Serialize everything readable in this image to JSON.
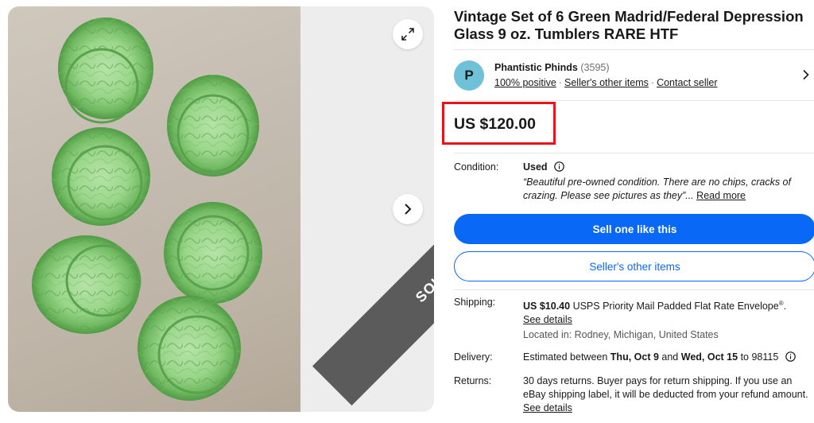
{
  "gallery": {
    "sold_label": "SOLD",
    "icons": {
      "expand": "expand-icon",
      "next": "chevron-right-icon"
    }
  },
  "listing": {
    "title": "Vintage Set of 6 Green Madrid/Federal Depression Glass 9 oz. Tumblers RARE HTF"
  },
  "seller": {
    "avatar_letter": "P",
    "name": "Phantistic Phinds",
    "feedback_count": "(3595)",
    "positive": "100% positive",
    "other_items_link": "Seller's other items",
    "contact_link": "Contact seller",
    "sep": "·"
  },
  "price": {
    "value": "US $120.00",
    "highlight_color": "#e5151b"
  },
  "condition": {
    "label": "Condition:",
    "value": "Used",
    "quote": "“Beautiful pre-owned condition. There are no chips, cracks of crazing. Please see pictures as they”...",
    "read_more": "Read more"
  },
  "actions": {
    "sell_one": "Sell one like this",
    "other_items": "Seller's other items",
    "primary_color": "#0968f6"
  },
  "shipping": {
    "label": "Shipping:",
    "amount": "US $10.40",
    "service": "USPS Priority Mail Padded Flat Rate Envelope",
    "reg": "®",
    "period": ".",
    "see_details": "See details",
    "located": "Located in: Rodney, Michigan, United States"
  },
  "delivery": {
    "label": "Delivery:",
    "prefix": "Estimated between",
    "start": "Thu, Oct 9",
    "and": "and",
    "end": "Wed, Oct 15",
    "to": "to 98115"
  },
  "returns": {
    "label": "Returns:",
    "text": "30 days returns. Buyer pays for return shipping. If you use an eBay shipping label, it will be deducted from your refund amount.",
    "see_details": "See details"
  }
}
